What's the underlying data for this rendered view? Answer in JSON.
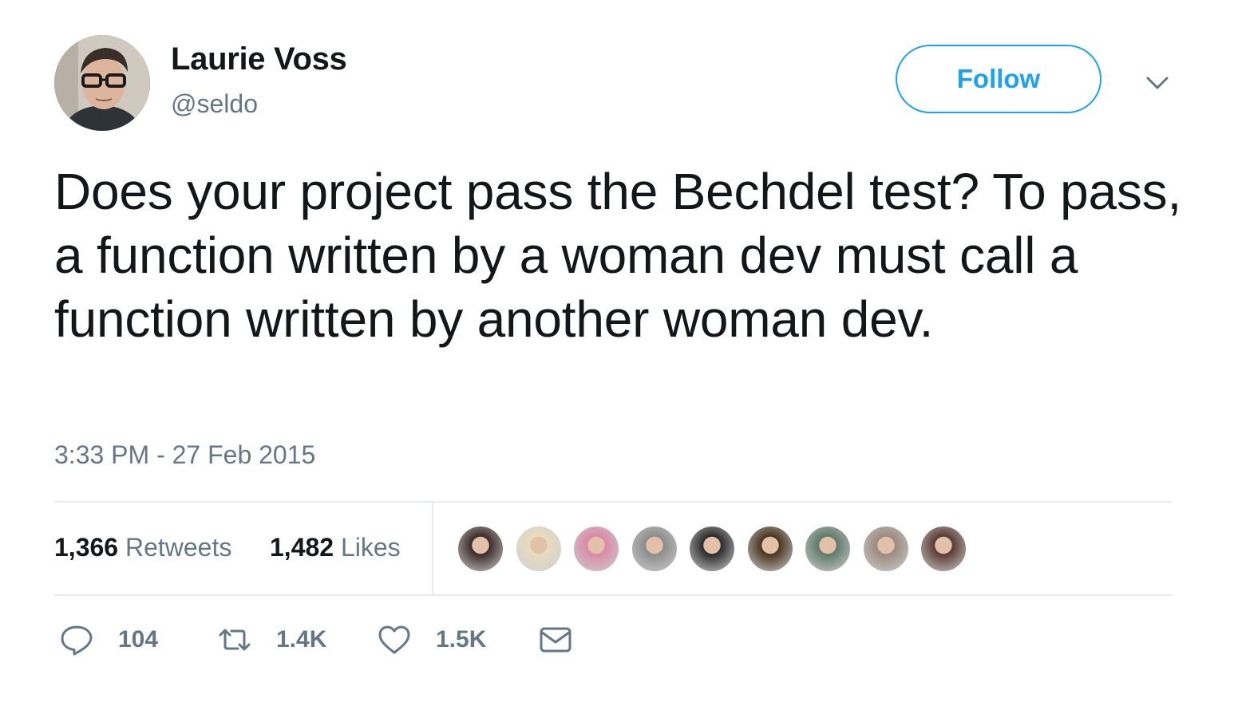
{
  "author": {
    "display_name": "Laurie Voss",
    "handle": "@seldo",
    "avatar_icon": "user-avatar"
  },
  "follow_button": {
    "label": "Follow",
    "color": "#1da1f2"
  },
  "menu_icon": "chevron-down-icon",
  "tweet": {
    "text": "Does your project pass the Bechdel test? To pass, a function written by a woman dev must call a function written by another woman dev.",
    "timestamp": "3:33 PM - 27 Feb 2015"
  },
  "stats": {
    "retweets": {
      "count": "1,366",
      "label": "Retweets"
    },
    "likes": {
      "count": "1,482",
      "label": "Likes"
    }
  },
  "liker_avatars": [
    {
      "name": "liker-avatar-1",
      "color": "#3a2a28"
    },
    {
      "name": "liker-avatar-2",
      "color": "#e8dcc0"
    },
    {
      "name": "liker-avatar-3",
      "color": "#d98aa8"
    },
    {
      "name": "liker-avatar-4",
      "color": "#8c8c8c"
    },
    {
      "name": "liker-avatar-5",
      "color": "#2a2a2a"
    },
    {
      "name": "liker-avatar-6",
      "color": "#4a3420"
    },
    {
      "name": "liker-avatar-7",
      "color": "#5e7a6a"
    },
    {
      "name": "liker-avatar-8",
      "color": "#9a8a80"
    },
    {
      "name": "liker-avatar-9",
      "color": "#5a3a34"
    }
  ],
  "actions": {
    "reply": {
      "icon": "reply-icon",
      "count": "104"
    },
    "retweet": {
      "icon": "retweet-icon",
      "count": "1.4K"
    },
    "like": {
      "icon": "heart-icon",
      "count": "1.5K"
    },
    "dm": {
      "icon": "envelope-icon"
    }
  },
  "colors": {
    "text": "#14171a",
    "secondary": "#657786",
    "divider": "#e6ecf0"
  }
}
